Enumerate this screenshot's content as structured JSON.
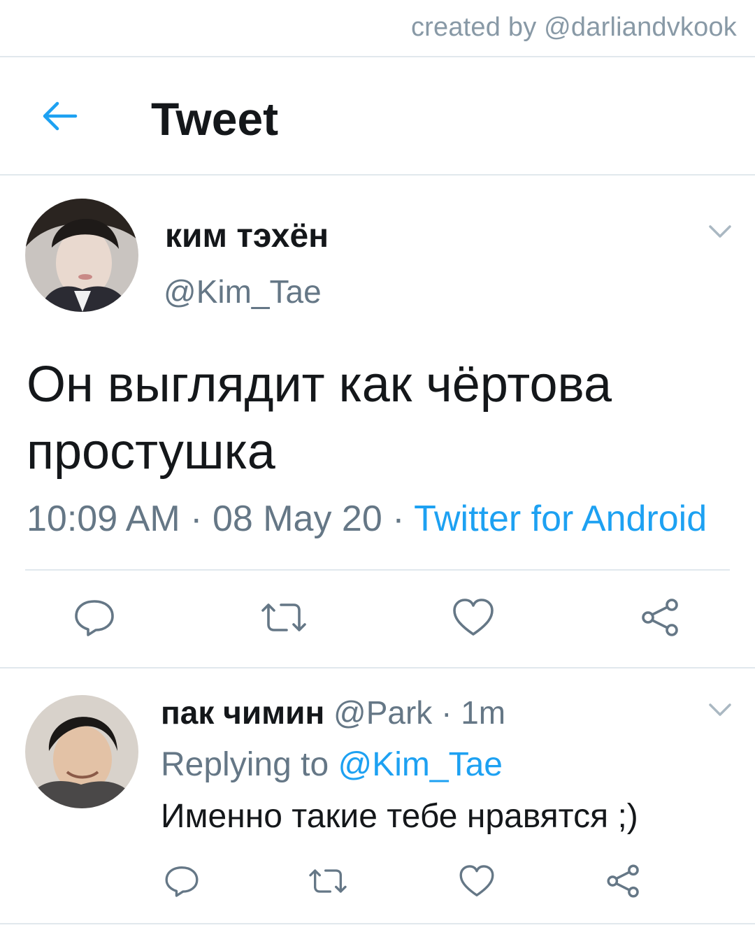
{
  "watermark": "created by @darliandvkook",
  "header": {
    "back_icon": "arrow-left-icon",
    "title": "Tweet"
  },
  "colors": {
    "accent": "#1da1f2",
    "secondary_text": "#657786",
    "divider": "#e1e8ed"
  },
  "main_tweet": {
    "author_name": "ким тэхён",
    "author_handle": "@Kim_Tae",
    "text": "Он выглядит как чёртова простушка",
    "time": "10:09 AM",
    "date": "08 May 20",
    "separator": "·",
    "source": "Twitter for Android",
    "actions": [
      "reply-icon",
      "retweet-icon",
      "like-icon",
      "share-icon"
    ]
  },
  "reply_tweet": {
    "author_name": "пак чимин",
    "author_handle": "@Park",
    "separator": "·",
    "age": "1m",
    "replying_prefix": "Replying to",
    "replying_handle": "@Kim_Tae",
    "text": "Именно такие тебе нравятся ;)",
    "actions": [
      "reply-icon",
      "retweet-icon",
      "like-icon",
      "share-icon"
    ]
  }
}
